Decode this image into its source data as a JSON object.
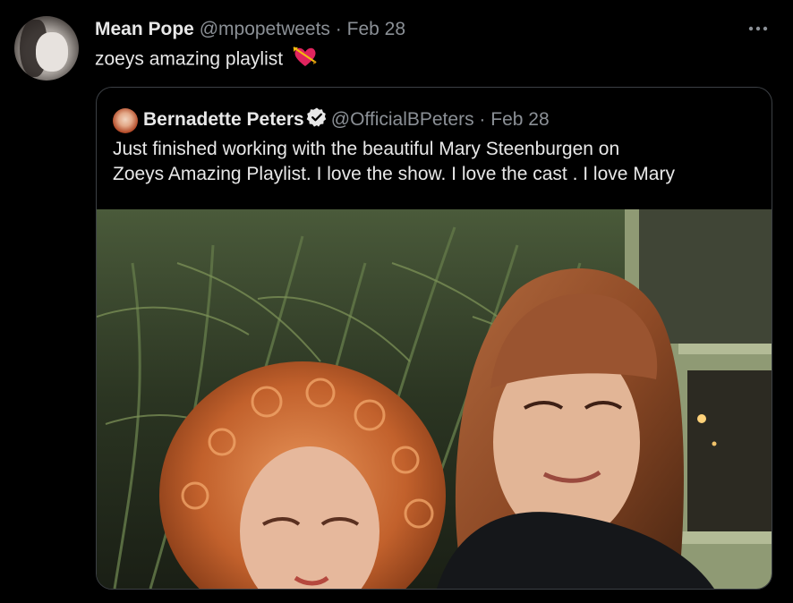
{
  "tweet": {
    "author_name": "Mean Pope",
    "author_handle": "@mpopetweets",
    "separator": "·",
    "date": "Feb 28",
    "text": "zoeys amazing playlist",
    "emoji_icon": "heart-with-arrow-icon",
    "more_icon": "more-horizontal-icon"
  },
  "quoted_tweet": {
    "author_name": "Bernadette Peters",
    "verified_icon": "verified-badge-icon",
    "author_handle": "@OfficialBPeters",
    "separator": "·",
    "date": "Feb 28",
    "text_line1": "Just finished working with the beautiful Mary Steenburgen on",
    "text_line2": "Zoeys Amazing Playlist. I love the show. I love the cast . I love Mary",
    "photo": "photo of two women in front of plants and a window"
  },
  "colors": {
    "background": "#000000",
    "text": "#e8e8e8",
    "muted": "#8b9096",
    "border": "#3c4045"
  }
}
